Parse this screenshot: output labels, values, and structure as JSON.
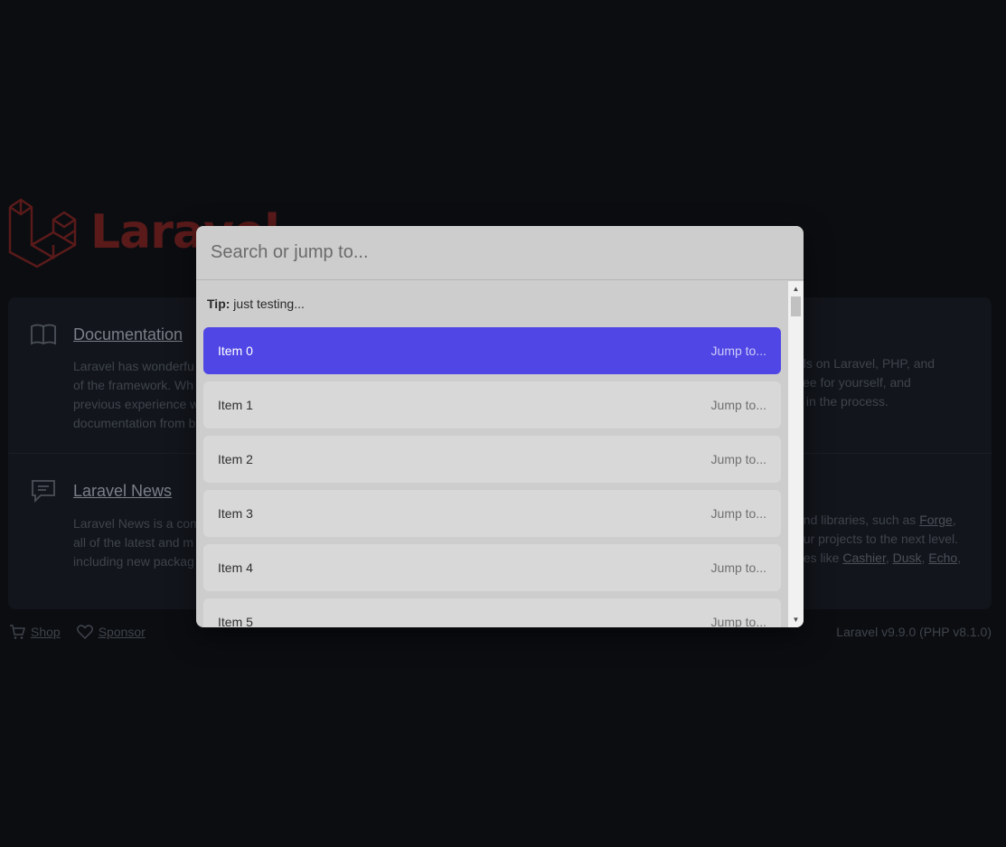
{
  "background": {
    "logo_text": "Laravel",
    "cells": [
      {
        "title": "Documentation",
        "lines": [
          "Laravel has wonderfu",
          "of the framework. Wh",
          "previous experience w",
          "documentation from b"
        ]
      },
      {
        "title": "",
        "lines": [
          "als on Laravel, PHP, and",
          "see for yourself, and",
          "s in the process."
        ]
      },
      {
        "title": "Laravel News",
        "lines": [
          "Laravel News is a com",
          "all of the latest and m",
          "including new packag"
        ]
      },
      {
        "title": "",
        "line1_prefix": "and libraries, such as ",
        "line1_link": "Forge",
        "line1_suffix": ",",
        "line2": "our projects to the next level.",
        "line3_prefix": "ries like ",
        "line3_links": [
          "Cashier",
          "Dusk",
          "Echo"
        ]
      }
    ],
    "footer": {
      "shop": "Shop",
      "sponsor": "Sponsor",
      "version": "Laravel v9.9.0 (PHP v8.1.0)"
    }
  },
  "palette": {
    "search_placeholder": "Search or jump to...",
    "tip_label": "Tip:",
    "tip_text": " just testing...",
    "items": [
      {
        "label": "Item 0",
        "action": "Jump to...",
        "active": true
      },
      {
        "label": "Item 1",
        "action": "Jump to..."
      },
      {
        "label": "Item 2",
        "action": "Jump to..."
      },
      {
        "label": "Item 3",
        "action": "Jump to..."
      },
      {
        "label": "Item 4",
        "action": "Jump to..."
      },
      {
        "label": "Item 5",
        "action": "Jump to..."
      }
    ]
  },
  "colors": {
    "accent": "#4f46e5",
    "overlay": "#0b0d11",
    "palette_bg": "#cdcdcd"
  }
}
